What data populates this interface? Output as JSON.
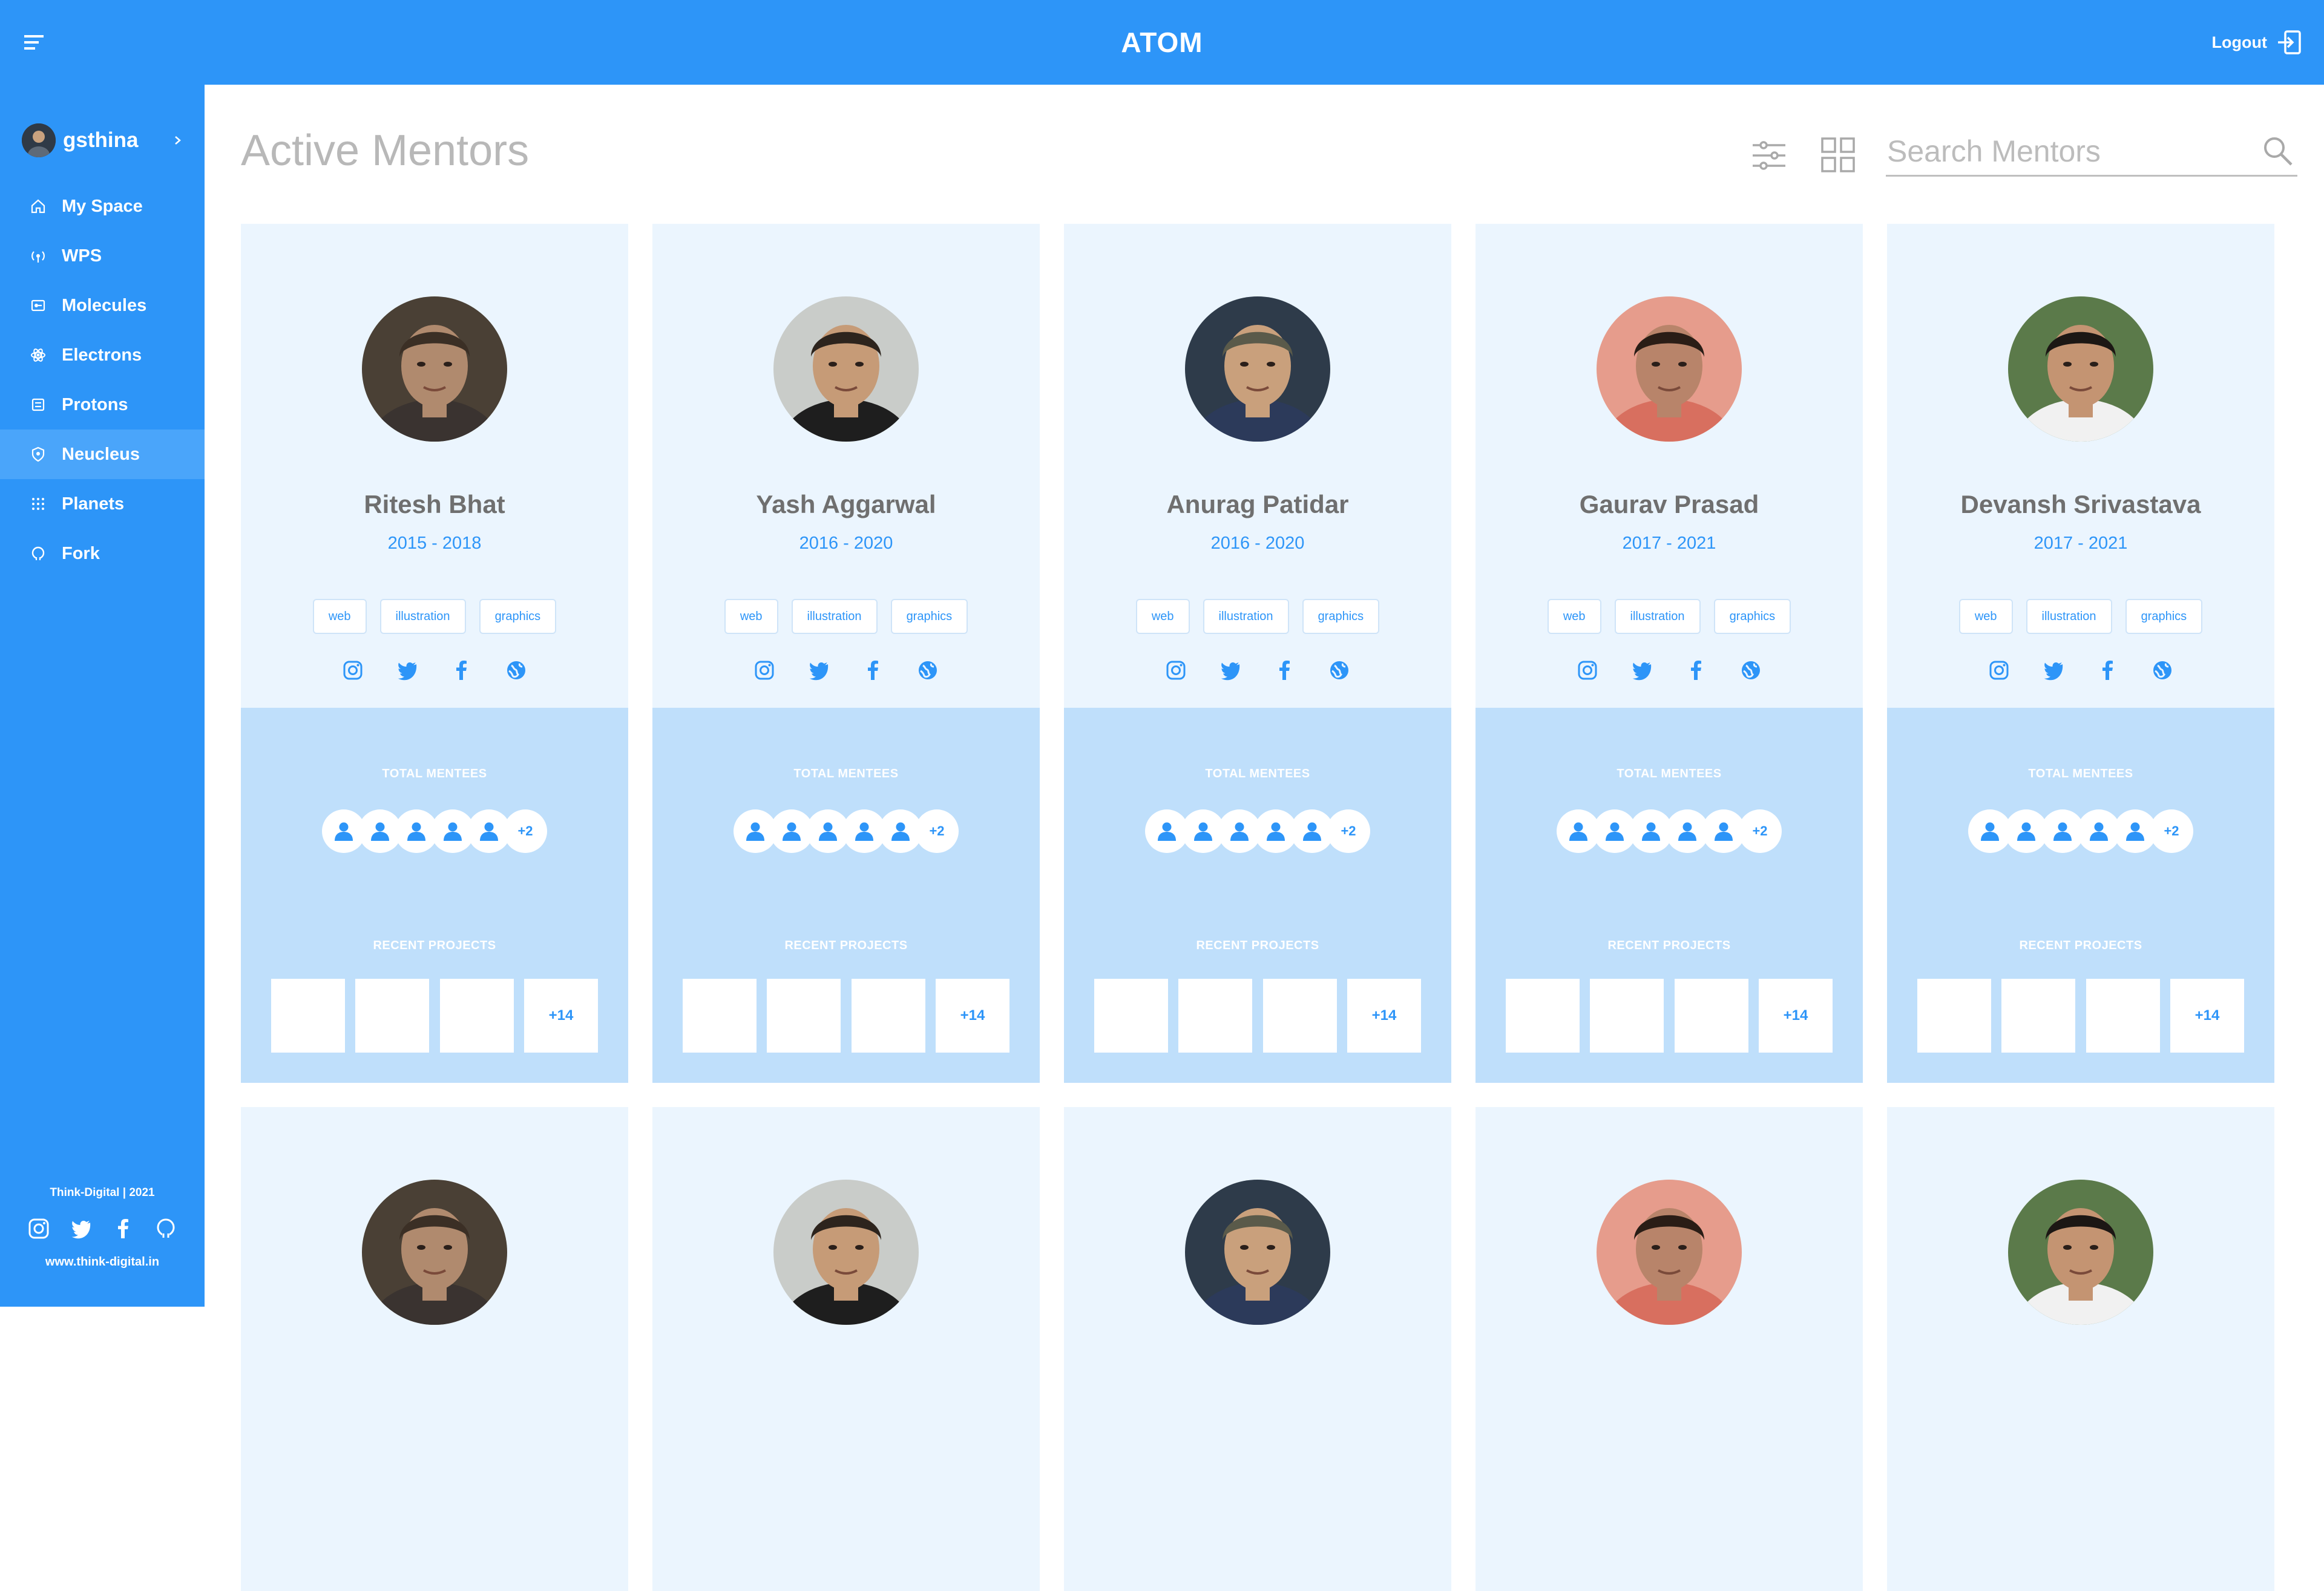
{
  "app": {
    "title": "ATOM",
    "logout_label": "Logout"
  },
  "user": {
    "name": "gsthina"
  },
  "sidebar": {
    "items": [
      {
        "label": "My Space",
        "icon": "home-icon"
      },
      {
        "label": "WPS",
        "icon": "broadcast-icon"
      },
      {
        "label": "Molecules",
        "icon": "molecules-icon"
      },
      {
        "label": "Electrons",
        "icon": "atom-icon"
      },
      {
        "label": "Protons",
        "icon": "proton-icon"
      },
      {
        "label": "Neucleus",
        "icon": "nucleus-icon",
        "active": true
      },
      {
        "label": "Planets",
        "icon": "grid-dots-icon"
      },
      {
        "label": "Fork",
        "icon": "github-icon"
      }
    ],
    "footer": {
      "copyright": "Think-Digital | 2021",
      "website": "www.think-digital.in"
    }
  },
  "page": {
    "title": "Active Mentors"
  },
  "search": {
    "placeholder": "Search Mentors",
    "value": ""
  },
  "card_labels": {
    "total_mentees": "TOTAL MENTEES",
    "recent_projects": "RECENT PROJECTS"
  },
  "mentors": [
    {
      "name": "Ritesh Bhat",
      "years": "2015 - 2018",
      "tags": [
        "web",
        "illustration",
        "graphics"
      ],
      "mentees_more": "+2",
      "projects_more": "+14"
    },
    {
      "name": "Yash Aggarwal",
      "years": "2016 - 2020",
      "tags": [
        "web",
        "illustration",
        "graphics"
      ],
      "mentees_more": "+2",
      "projects_more": "+14"
    },
    {
      "name": "Anurag Patidar",
      "years": "2016 - 2020",
      "tags": [
        "web",
        "illustration",
        "graphics"
      ],
      "mentees_more": "+2",
      "projects_more": "+14"
    },
    {
      "name": "Gaurav Prasad",
      "years": "2017 - 2021",
      "tags": [
        "web",
        "illustration",
        "graphics"
      ],
      "mentees_more": "+2",
      "projects_more": "+14"
    },
    {
      "name": "Devansh Srivastava",
      "years": "2017 - 2021",
      "tags": [
        "web",
        "illustration",
        "graphics"
      ],
      "mentees_more": "+2",
      "projects_more": "+14"
    }
  ],
  "colors": {
    "primary": "#2d95f8",
    "card_top": "#ebf5fe",
    "card_bottom": "#bfdffb",
    "active_nav": "#4aa5fa"
  }
}
